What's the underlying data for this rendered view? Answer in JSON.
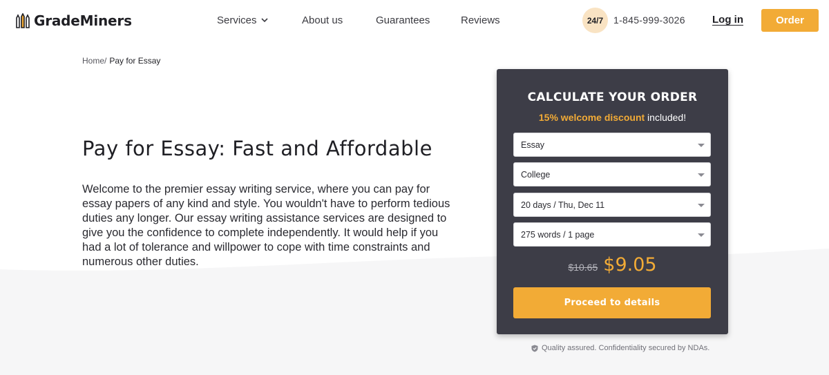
{
  "header": {
    "logo_text": "GradeMiners",
    "nav": [
      {
        "label": "Services"
      },
      {
        "label": "About us"
      },
      {
        "label": "Guarantees"
      },
      {
        "label": "Reviews"
      }
    ],
    "support_badge": "24/7",
    "phone": "1-845-999-3026",
    "login_label": "Log in",
    "order_label": "Order"
  },
  "breadcrumb": {
    "home": "Home/",
    "current": "Pay for Essay"
  },
  "hero": {
    "title": "Pay for Essay: Fast and Affordable",
    "intro": "Welcome to the premier essay writing service, where you can pay for essay papers of any kind and style. You wouldn't have to perform tedious duties any longer. Our essay writing assistance services are designed to give you the confidence to complete independently. It would help if you had a lot of tolerance and willpower to cope with time constraints and numerous other duties."
  },
  "calculator": {
    "title": "CALCULATE YOUR ORDER",
    "discount_highlight": "15% welcome discount",
    "discount_suffix": " included!",
    "selects": [
      {
        "value": "Essay"
      },
      {
        "value": "College"
      },
      {
        "value": "20 days / Thu, Dec 11"
      },
      {
        "value": "275 words / 1 page"
      }
    ],
    "old_price": "$10.65",
    "new_price": "$9.05",
    "proceed_label": "Proceed to details"
  },
  "footer_note": "Quality assured. Confidentiality secured by NDAs.",
  "colors": {
    "accent": "#f2ab36",
    "card_bg": "#3d3d47",
    "badge_bg": "#f9e3c3"
  }
}
